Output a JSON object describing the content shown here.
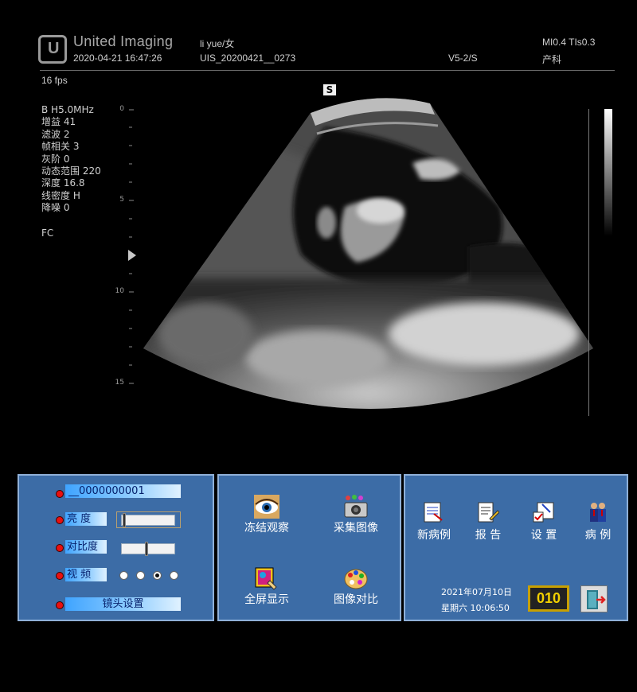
{
  "header": {
    "brand": "United Imaging",
    "logo_letter": "U",
    "datetime": "2020-04-21  16:47:26",
    "patient": "li yue/女",
    "exam_id": "UIS_20200421__0273",
    "probe": "V5-2/S",
    "mi_ti": "MI0.4  TIs0.3",
    "dept": "产科",
    "fps": "16 fps"
  },
  "scan_params": [
    "B   H5.0MHz",
    "增益 41",
    "滤波 2",
    "帧相关 3",
    "灰阶 0",
    "动态范围 220",
    "深度 16.8",
    "线密度 H",
    "降噪 0"
  ],
  "fc_label": "FC",
  "orientation_marker": "S",
  "depth_scale": {
    "labels": [
      "0",
      "5",
      "10",
      "15"
    ],
    "max_cm": 16.8
  },
  "controls": {
    "preset_label": "__0000000001",
    "brightness_label": "亮  度",
    "brightness_level": 0.05,
    "contrast_label": "对比度",
    "contrast_level": 0.45,
    "video_label": "视  频",
    "video_options": 4,
    "video_selected": 3,
    "lens_label": "镜头设置"
  },
  "image_tools": {
    "freeze": "冻结观察",
    "capture": "采集图像",
    "fullscreen": "全屏显示",
    "compare": "图像对比"
  },
  "actions": {
    "new_case": "新病例",
    "report": "报  告",
    "settings": "设  置",
    "cases": "病  例"
  },
  "system": {
    "date": "2021年07月10日",
    "weekday_time": "星期六  10:06:50",
    "counter": "010"
  },
  "icons": {
    "logo": "united-imaging-logo",
    "freeze": "eye-icon",
    "capture": "camera-icon",
    "fullscreen": "picture-frame-icon",
    "compare": "palette-icon",
    "new_case": "new-document-icon",
    "report": "report-icon",
    "settings": "settings-check-icon",
    "cases": "people-icon",
    "exit": "exit-door-icon"
  },
  "colors": {
    "panel": "#3c6ca6",
    "indicator": "#e81010",
    "counter_text": "#f2d000"
  }
}
